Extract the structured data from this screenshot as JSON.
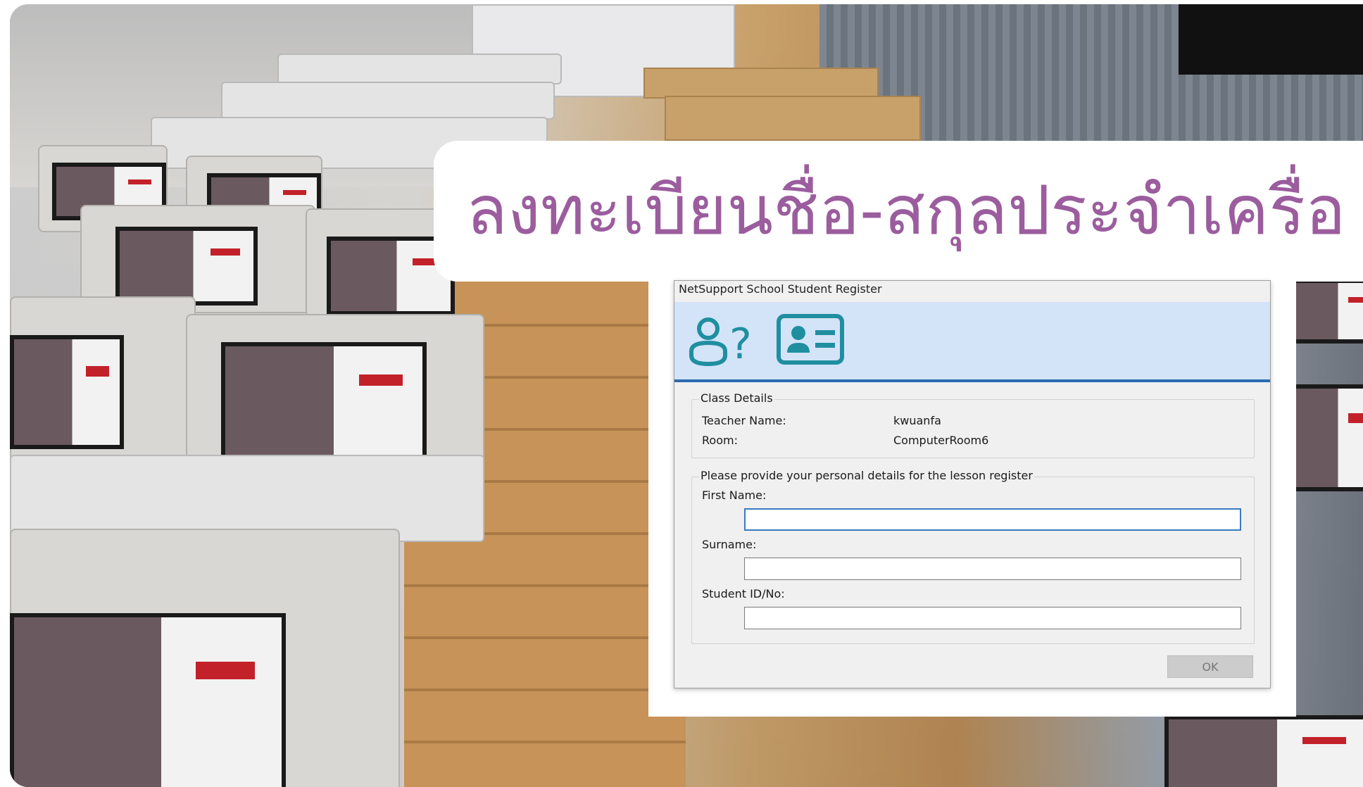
{
  "banner": {
    "title": "ลงทะเบียนชื่อ-สกุลประจำเครื่อ"
  },
  "dialog": {
    "title": "NetSupport School Student Register",
    "header_icons": [
      "user-question-icon",
      "id-card-icon"
    ],
    "class_details": {
      "group_title": "Class Details",
      "teacher_label": "Teacher Name:",
      "teacher_value": "kwuanfa",
      "room_label": "Room:",
      "room_value": "ComputerRoom6"
    },
    "personal": {
      "group_title": "Please provide your personal details for the lesson register",
      "first_name_label": "First Name:",
      "first_name_value": "",
      "surname_label": "Surname:",
      "surname_value": "",
      "student_id_label": "Student ID/No:",
      "student_id_value": ""
    },
    "ok_label": "OK"
  },
  "colors": {
    "banner_text": "#9b5d9e",
    "header_bg": "#d3e4f8",
    "header_line": "#2b6cb0",
    "icon_teal": "#1f8fa0"
  }
}
